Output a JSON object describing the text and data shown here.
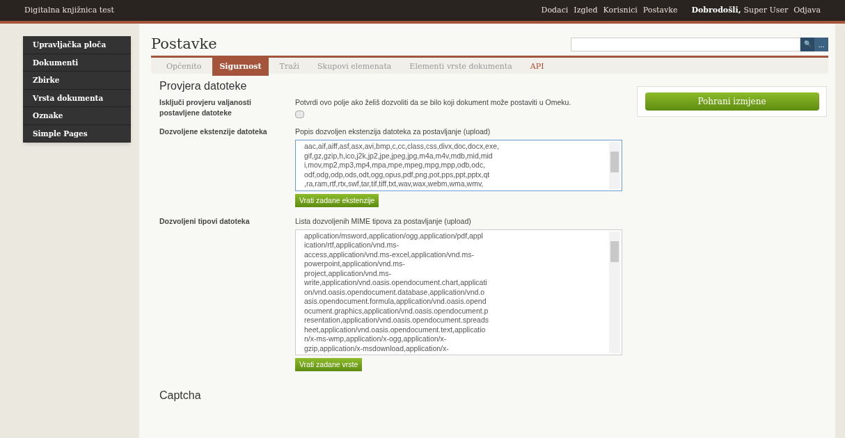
{
  "top_bar": {
    "site_title": "Digitalna knjižnica test",
    "links": [
      "Dodaci",
      "Izgled",
      "Korisnici",
      "Postavke"
    ],
    "welcome": "Dobrodošli,",
    "user": "Super User",
    "logout": "Odjava"
  },
  "sidebar": {
    "items": [
      {
        "label": "Upravljačka ploča"
      },
      {
        "label": "Dokumenti"
      },
      {
        "label": "Zbirke"
      },
      {
        "label": "Vrsta dokumenta"
      },
      {
        "label": "Oznake"
      },
      {
        "label": "Simple Pages"
      }
    ]
  },
  "page_title": "Postavke",
  "search": {
    "button": "🔍",
    "more": "..."
  },
  "tabs": [
    {
      "label": "Općenito",
      "selected": false,
      "kind": "normal"
    },
    {
      "label": "Sigurnost",
      "selected": true,
      "kind": "normal"
    },
    {
      "label": "Traži",
      "selected": false,
      "kind": "normal"
    },
    {
      "label": "Skupovi elemenata",
      "selected": false,
      "kind": "normal"
    },
    {
      "label": "Elementi vrste dokumenta",
      "selected": false,
      "kind": "normal"
    },
    {
      "label": "API",
      "selected": false,
      "kind": "accent"
    }
  ],
  "save_button": "Pohrani izmjene",
  "sections": [
    {
      "heading": "Provjera datoteke",
      "fields": [
        {
          "kind": "checkbox",
          "label": "Isključi provjeru valjanosti postavljene datoteke",
          "description": "Potvrdi ovo polje ako želiš dozvoliti da se bilo koji dokument može postaviti u Omeku.",
          "checked": false
        },
        {
          "kind": "textarea",
          "label": "Dozvoljene ekstenzije datoteka",
          "description": "Popis dozvoljen ekstenzija datoteka za postavljanje (upload)",
          "focused": true,
          "lines": [
            "aac,aif,aiff,asf,asx,avi,bmp,c,cc,class,css,divx,doc,docx,exe,",
            "gif,gz,gzip,h,ico,j2k,jp2,jpe,jpeg,jpg,m4a,m4v,mdb,mid,mid",
            "i,mov,mp2,mp3,mp4,mpa,mpe,mpeg,mpg,mpp,odb,odc,",
            "odf,odg,odp,ods,odt,ogg,opus,pdf,png,pot,pps,ppt,pptx,qt",
            ",ra,ram,rtf,rtx,swf,tar,tif,tiff,txt,wav,wax,webm,wma,wmv,"
          ],
          "button": "Vrati zadane ekstenzije"
        },
        {
          "kind": "textarea",
          "label": "Dozvoljeni tipovi datoteka",
          "description": "Lista dozvoljenih MIME tipova za postavljanje (upload)",
          "focused": false,
          "lines": [
            "application/msword,application/ogg,application/pdf,appl",
            "ication/rtf,application/vnd.ms-",
            "access,application/vnd.ms-excel,application/vnd.ms-",
            "powerpoint,application/vnd.ms-",
            "project,application/vnd.ms-",
            "write,application/vnd.oasis.opendocument.chart,applicati",
            "on/vnd.oasis.opendocument.database,application/vnd.o",
            "asis.opendocument.formula,application/vnd.oasis.opend",
            "ocument.graphics,application/vnd.oasis.opendocument.p",
            "resentation,application/vnd.oasis.opendocument.spreads",
            "heet,application/vnd.oasis.opendocument.text,applicatio",
            "n/x-ms-wmp,application/x-ogg,application/x-",
            "gzip,application/x-msdownload,application/x-"
          ],
          "button": "Vrati zadane vrste"
        }
      ]
    },
    {
      "heading": "Captcha"
    }
  ]
}
